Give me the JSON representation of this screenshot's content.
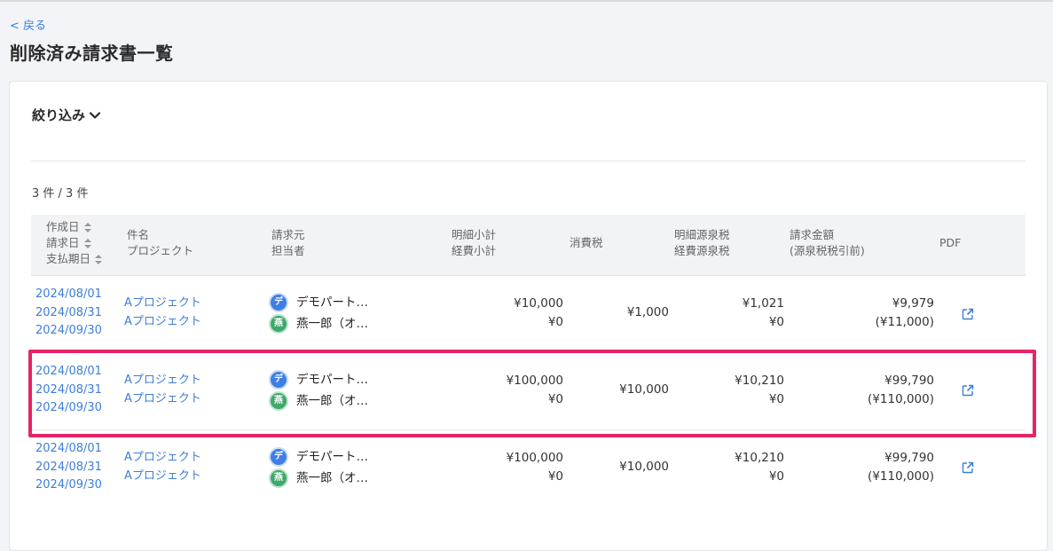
{
  "nav": {
    "back_label": "< 戻る"
  },
  "page": {
    "title": "削除済み請求書一覧"
  },
  "filter": {
    "label": "絞り込み"
  },
  "summary": {
    "count": "3 件 / 3 件"
  },
  "table": {
    "headers": {
      "dates": [
        "作成日",
        "請求日",
        "支払期日"
      ],
      "subject": [
        "件名",
        "プロジェクト"
      ],
      "issuer": [
        "請求元",
        "担当者"
      ],
      "subtotal": [
        "明細小計",
        "経費小計"
      ],
      "tax": "消費税",
      "withholding": [
        "明細源泉税",
        "経費源泉税"
      ],
      "amount": [
        "請求金額",
        "(源泉税税引前)"
      ],
      "pdf": "PDF"
    },
    "rows": [
      {
        "created": "2024/08/01",
        "billed": "2024/08/31",
        "due": "2024/09/30",
        "subject": "Aプロジェクト",
        "project": "Aプロジェクト",
        "company_initial": "デ",
        "company": "デモパート…",
        "person_initial": "燕",
        "person": "燕一郎（オ…",
        "line_subtotal": "¥10,000",
        "expense_subtotal": "¥0",
        "tax": "¥1,000",
        "line_withholding": "¥1,021",
        "expense_withholding": "¥0",
        "amount": "¥9,979",
        "amount_pre": "(¥11,000)"
      },
      {
        "created": "2024/08/01",
        "billed": "2024/08/31",
        "due": "2024/09/30",
        "subject": "Aプロジェクト",
        "project": "Aプロジェクト",
        "company_initial": "デ",
        "company": "デモパート…",
        "person_initial": "燕",
        "person": "燕一郎（オ…",
        "line_subtotal": "¥100,000",
        "expense_subtotal": "¥0",
        "tax": "¥10,000",
        "line_withholding": "¥10,210",
        "expense_withholding": "¥0",
        "amount": "¥99,790",
        "amount_pre": "(¥110,000)"
      },
      {
        "created": "2024/08/01",
        "billed": "2024/08/31",
        "due": "2024/09/30",
        "subject": "Aプロジェクト",
        "project": "Aプロジェクト",
        "company_initial": "デ",
        "company": "デモパート…",
        "person_initial": "燕",
        "person": "燕一郎（オ…",
        "line_subtotal": "¥100,000",
        "expense_subtotal": "¥0",
        "tax": "¥10,000",
        "line_withholding": "¥10,210",
        "expense_withholding": "¥0",
        "amount": "¥99,790",
        "amount_pre": "(¥110,000)"
      }
    ]
  },
  "colors": {
    "link": "#3d7ed8",
    "highlight": "#e6246a",
    "avatar_company": "#3f7ee6",
    "avatar_person": "#3fa86b"
  },
  "icons": {
    "filter_toggle": "chevron-down-icon",
    "pdf": "external-link-icon",
    "sort": "sort-icon"
  }
}
